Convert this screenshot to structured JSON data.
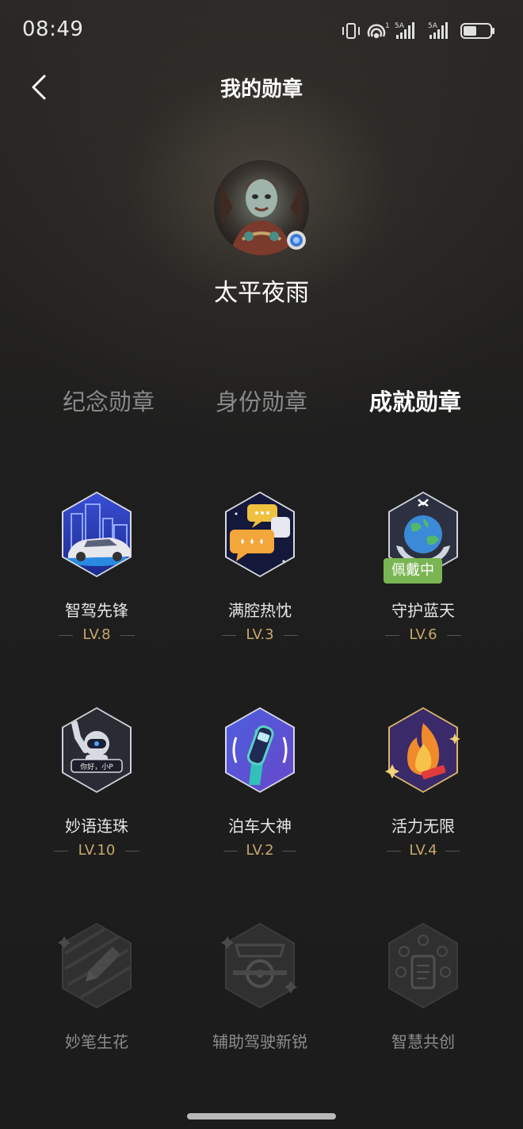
{
  "status_bar": {
    "time": "08:49",
    "network_label_1": "5A",
    "network_label_2": "5A",
    "wifi_sub": "1"
  },
  "header": {
    "title": "我的勋章"
  },
  "profile": {
    "username": "太平夜雨"
  },
  "tabs": [
    {
      "label": "纪念勋章",
      "active": false
    },
    {
      "label": "身份勋章",
      "active": false
    },
    {
      "label": "成就勋章",
      "active": true
    }
  ],
  "badges": [
    {
      "name": "智驾先锋",
      "level": "LV.8",
      "icon": "car-city-badge-icon",
      "unlocked": true
    },
    {
      "name": "满腔热忱",
      "level": "LV.3",
      "icon": "chat-bubbles-badge-icon",
      "unlocked": true
    },
    {
      "name": "守护蓝天",
      "level": "LV.6",
      "icon": "earth-hands-badge-icon",
      "unlocked": true,
      "tag": "佩戴中"
    },
    {
      "name": "妙语连珠",
      "level": "LV.10",
      "icon": "voice-assistant-badge-icon",
      "unlocked": true,
      "icon_text": "你好，小P"
    },
    {
      "name": "泊车大神",
      "level": "LV.2",
      "icon": "parking-car-badge-icon",
      "unlocked": true
    },
    {
      "name": "活力无限",
      "level": "LV.4",
      "icon": "flame-badge-icon",
      "unlocked": true
    },
    {
      "name": "妙笔生花",
      "icon": "pen-badge-icon",
      "unlocked": false
    },
    {
      "name": "辅助驾驶新锐",
      "icon": "assisted-driving-badge-icon",
      "unlocked": false
    },
    {
      "name": "智慧共创",
      "icon": "co-creation-badge-icon",
      "unlocked": false
    }
  ],
  "colors": {
    "level_gold": "#c9a86a",
    "wearing_green": "#7ab553",
    "inactive_tab": "#8a8a8a"
  }
}
